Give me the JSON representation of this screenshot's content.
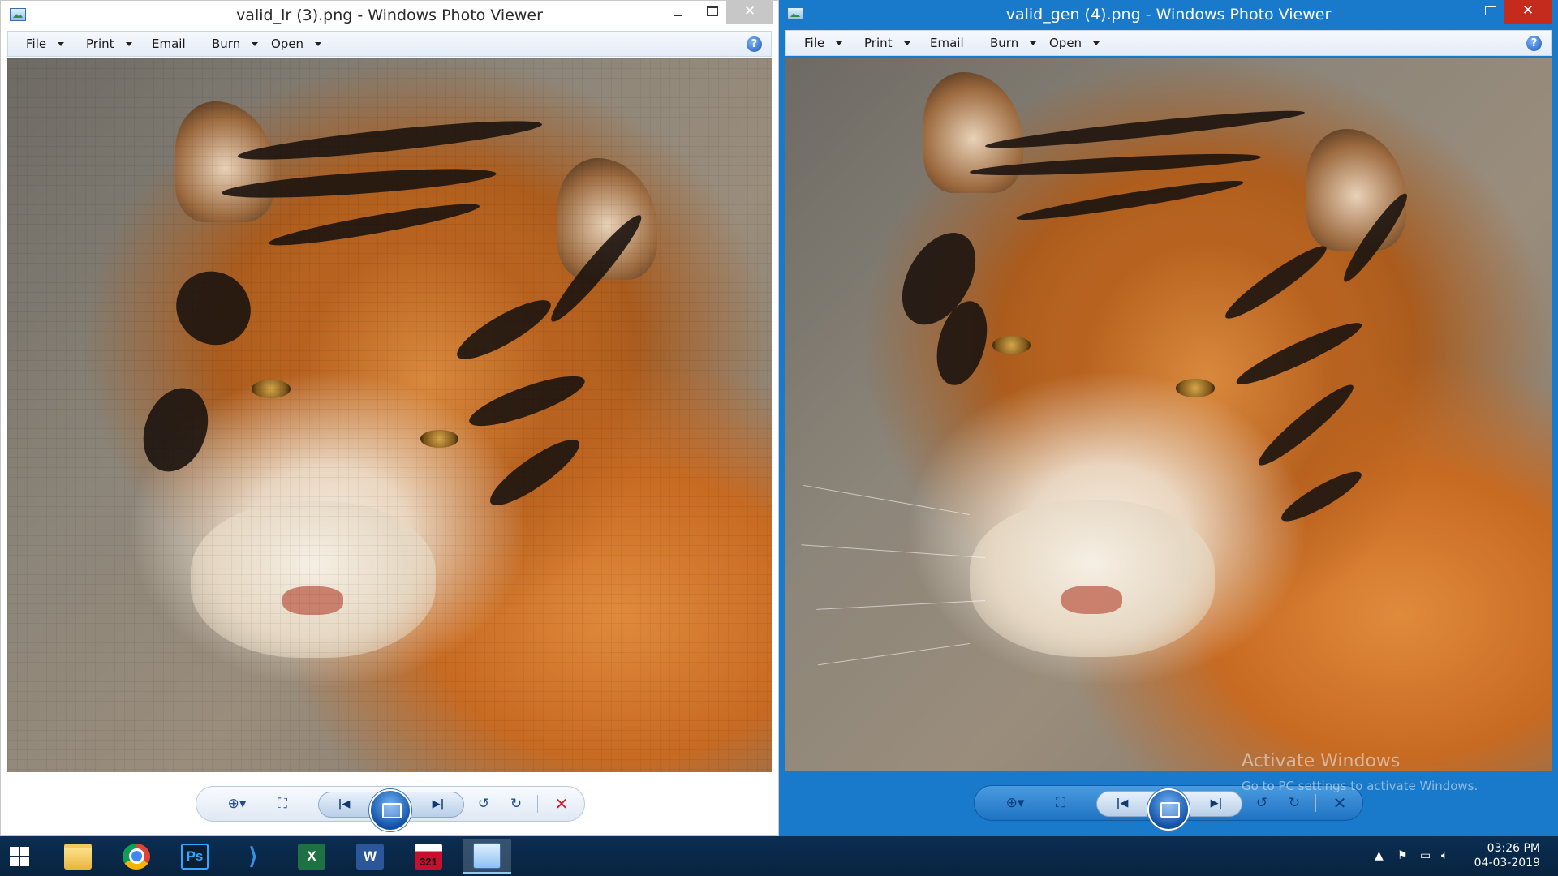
{
  "left_window": {
    "title": "valid_lr (3).png - Windows Photo Viewer",
    "menu": {
      "file": "File",
      "print": "Print",
      "email": "Email",
      "burn": "Burn",
      "open": "Open"
    }
  },
  "right_window": {
    "title": "valid_gen (4).png - Windows Photo Viewer",
    "menu": {
      "file": "File",
      "print": "Print",
      "email": "Email",
      "burn": "Burn",
      "open": "Open"
    }
  },
  "watermark": {
    "title": "Activate Windows",
    "subtitle": "Go to PC settings to activate Windows."
  },
  "taskbar": {
    "apps": [
      {
        "name": "File Explorer",
        "icon": "folder-icon"
      },
      {
        "name": "Google Chrome",
        "icon": "chrome-icon"
      },
      {
        "name": "Photoshop",
        "icon": "photoshop-icon",
        "glyph": "Ps"
      },
      {
        "name": "Visual Studio Code",
        "icon": "vscode-icon",
        "glyph": "⟩"
      },
      {
        "name": "Excel",
        "icon": "excel-icon",
        "glyph": "X"
      },
      {
        "name": "Word",
        "icon": "word-icon",
        "glyph": "W"
      },
      {
        "name": "Calendar",
        "icon": "calendar-icon",
        "glyph": "321"
      },
      {
        "name": "Windows Photo Viewer",
        "icon": "photo-viewer-icon"
      }
    ],
    "clock_time": "03:26 PM",
    "clock_date": "04-03-2019"
  },
  "colors": {
    "active_titlebar": "#1979ca",
    "close_active": "#c42b1c",
    "taskbar": "#0b2e52"
  }
}
